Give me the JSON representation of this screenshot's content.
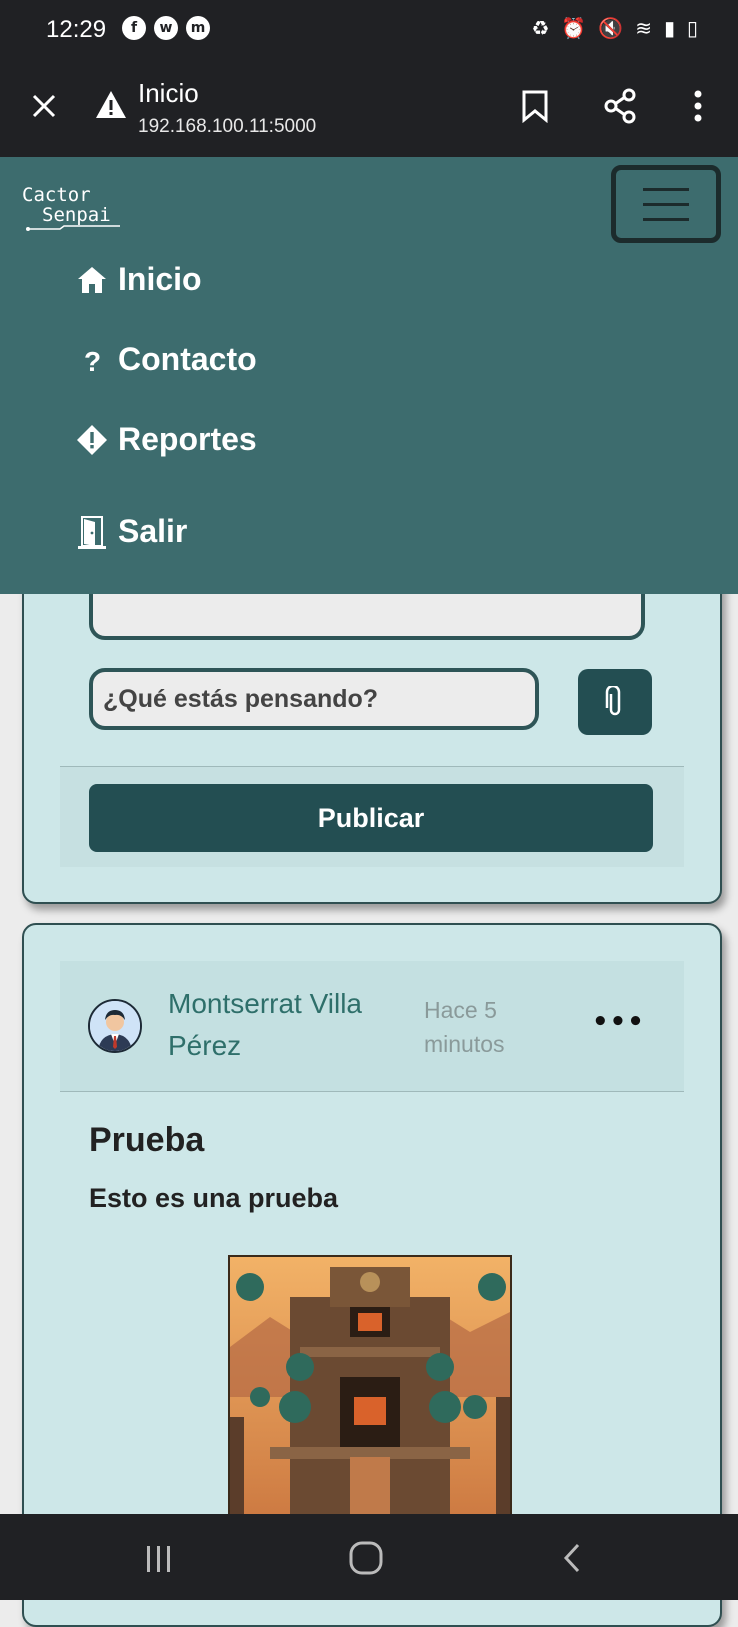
{
  "status_bar": {
    "time": "12:29"
  },
  "browser": {
    "page_title": "Inicio",
    "url": "192.168.100.11:5000"
  },
  "brand": {
    "line1": "Cactor",
    "line2": "Senpai"
  },
  "nav": {
    "items": [
      {
        "label": "Inicio",
        "icon": "home-icon"
      },
      {
        "label": "Contacto",
        "icon": "question-icon"
      },
      {
        "label": "Reportes",
        "icon": "warning-diamond-icon"
      },
      {
        "label": "Salir",
        "icon": "door-icon"
      }
    ]
  },
  "composer": {
    "placeholder": "¿Qué estás pensando?",
    "publish_label": "Publicar"
  },
  "post": {
    "author": "Montserrat Villa Pérez",
    "time_ago": "Hace 5 minutos",
    "more": "•••",
    "title": "Prueba",
    "body": "Esto es una prueba"
  },
  "colors": {
    "navbar": "#3d6c6e",
    "card_bg": "#cde7e8",
    "primary_button": "#234e52",
    "author_text": "#2e6f6a"
  }
}
